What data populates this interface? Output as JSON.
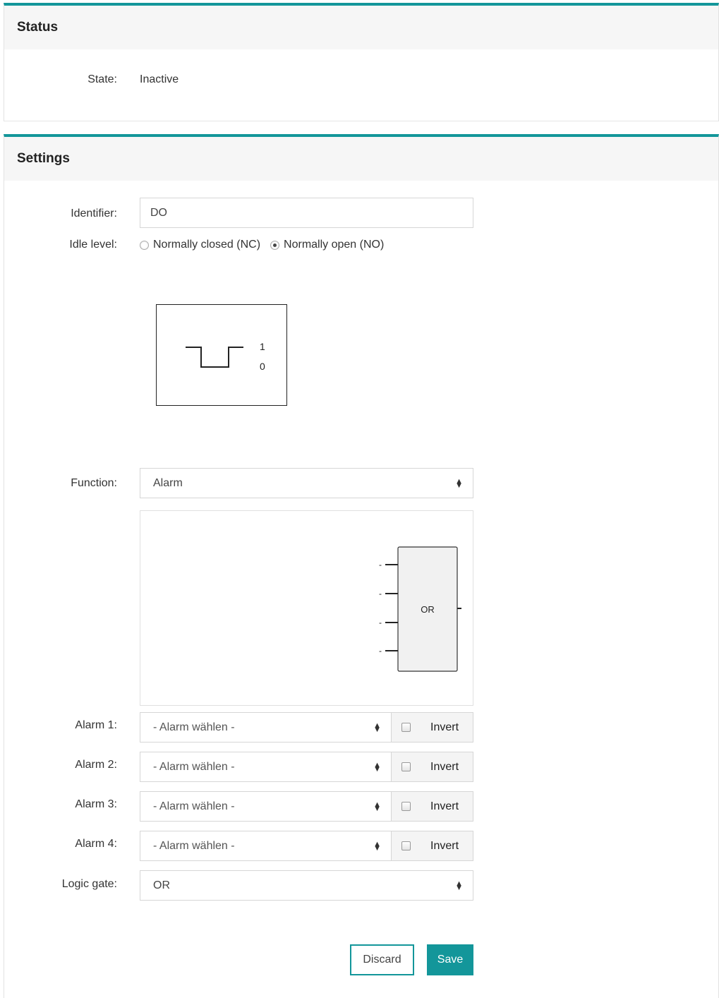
{
  "status": {
    "title": "Status",
    "state_label": "State:",
    "state_value": "Inactive"
  },
  "settings": {
    "title": "Settings",
    "identifier_label": "Identifier:",
    "identifier_value": "DO",
    "idle_level_label": "Idle level:",
    "idle_options": [
      {
        "label": "Normally closed (NC)",
        "selected": false
      },
      {
        "label": "Normally open (NO)",
        "selected": true
      }
    ],
    "level_diagram": {
      "high_label": "1",
      "low_label": "0"
    },
    "function_label": "Function:",
    "function_value": "Alarm",
    "logic_diagram": {
      "gate_label": "OR",
      "input_labels": [
        "-",
        "-",
        "-",
        "-"
      ]
    },
    "alarms": [
      {
        "label": "Alarm 1:",
        "value": "- Alarm wählen -",
        "invert_label": "Invert",
        "invert_checked": false
      },
      {
        "label": "Alarm 2:",
        "value": "- Alarm wählen -",
        "invert_label": "Invert",
        "invert_checked": false
      },
      {
        "label": "Alarm 3:",
        "value": "- Alarm wählen -",
        "invert_label": "Invert",
        "invert_checked": false
      },
      {
        "label": "Alarm 4:",
        "value": "- Alarm wählen -",
        "invert_label": "Invert",
        "invert_checked": false
      }
    ],
    "logic_gate_label": "Logic gate:",
    "logic_gate_value": "OR",
    "discard_label": "Discard",
    "save_label": "Save"
  },
  "colors": {
    "accent": "#13969a",
    "panel_header_bg": "#f6f6f6"
  }
}
